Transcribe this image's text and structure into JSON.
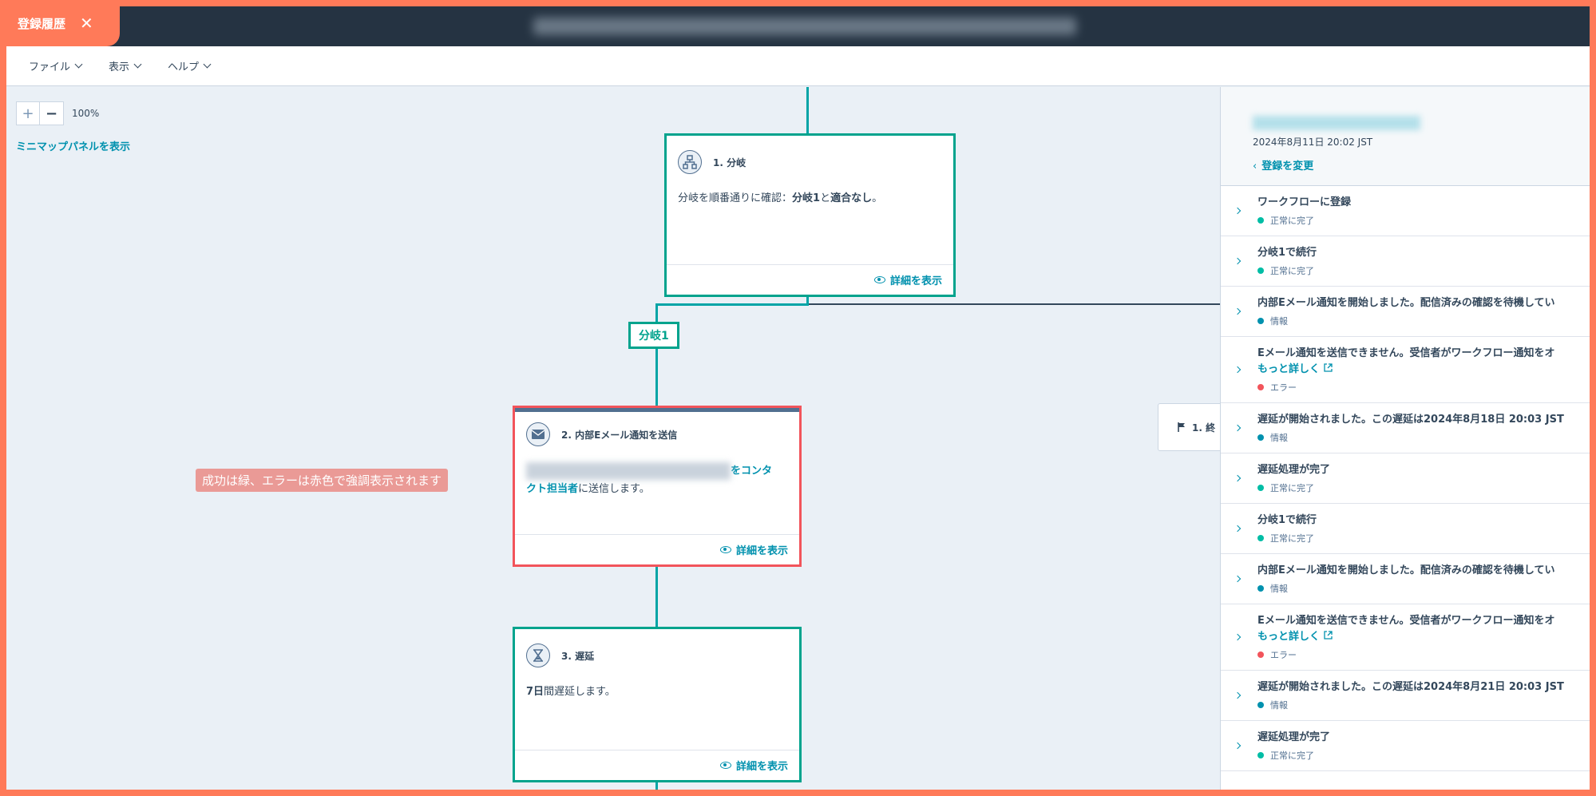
{
  "history_tab": {
    "label": "登録履歴",
    "close": "✕"
  },
  "menu": [
    {
      "label": "ファイル"
    },
    {
      "label": "表示"
    },
    {
      "label": "ヘルプ"
    }
  ],
  "zoom": {
    "plus": "+",
    "minus": "−",
    "level": "100%",
    "minimap_link": "ミニマップパネルを表示"
  },
  "callout": "成功は緑、エラーは赤色で強調表示されます",
  "branch_label": "分岐1",
  "end_node": {
    "label": "1. 終"
  },
  "cards": [
    {
      "title": "1. 分岐",
      "body_prefix": "分岐を順番通りに確認：",
      "body_bold1": "分岐1",
      "body_mid": "と",
      "body_bold2": "適合なし",
      "body_suffix": "。",
      "view_label": "詳細を表示"
    },
    {
      "title": "2. 内部Eメール通知を送信",
      "body_link_start": "をコンタ",
      "body_link_end": "クト担当者",
      "body_suffix": "に送信します。",
      "view_label": "詳細を表示"
    },
    {
      "title": "3. 遅延",
      "body_bold": "7日",
      "body_suffix": "間遅延します。",
      "view_label": "詳細を表示"
    }
  ],
  "panel": {
    "date": "2024年8月11日 20:02 JST",
    "change_label": "登録を変更",
    "events": [
      {
        "title": "ワークフローに登録",
        "status": "正常に完了",
        "type": "success"
      },
      {
        "title": "分岐1で続行",
        "status": "正常に完了",
        "type": "success"
      },
      {
        "title": "内部Eメール通知を開始しました。配信済みの確認を待機してい",
        "status": "情報",
        "type": "info"
      },
      {
        "title": "Eメール通知を送信できません。受信者がワークフロー通知をオ",
        "link": "もっと詳しく",
        "status": "エラー",
        "type": "error"
      },
      {
        "title": "遅延が開始されました。この遅延は2024年8月18日 20:03 JST",
        "status": "情報",
        "type": "info"
      },
      {
        "title": "遅延処理が完了",
        "status": "正常に完了",
        "type": "success"
      },
      {
        "title": "分岐1で続行",
        "status": "正常に完了",
        "type": "success"
      },
      {
        "title": "内部Eメール通知を開始しました。配信済みの確認を待機してい",
        "status": "情報",
        "type": "info"
      },
      {
        "title": "Eメール通知を送信できません。受信者がワークフロー通知をオ",
        "link": "もっと詳しく",
        "status": "エラー",
        "type": "error"
      },
      {
        "title": "遅延が開始されました。この遅延は2024年8月21日 20:03 JST",
        "status": "情報",
        "type": "info"
      },
      {
        "title": "遅延処理が完了",
        "status": "正常に完了",
        "type": "success"
      }
    ]
  },
  "colors": {
    "success": "#00bda5",
    "info": "#0091ae",
    "error": "#f2545b",
    "accent": "#ff7a59"
  }
}
